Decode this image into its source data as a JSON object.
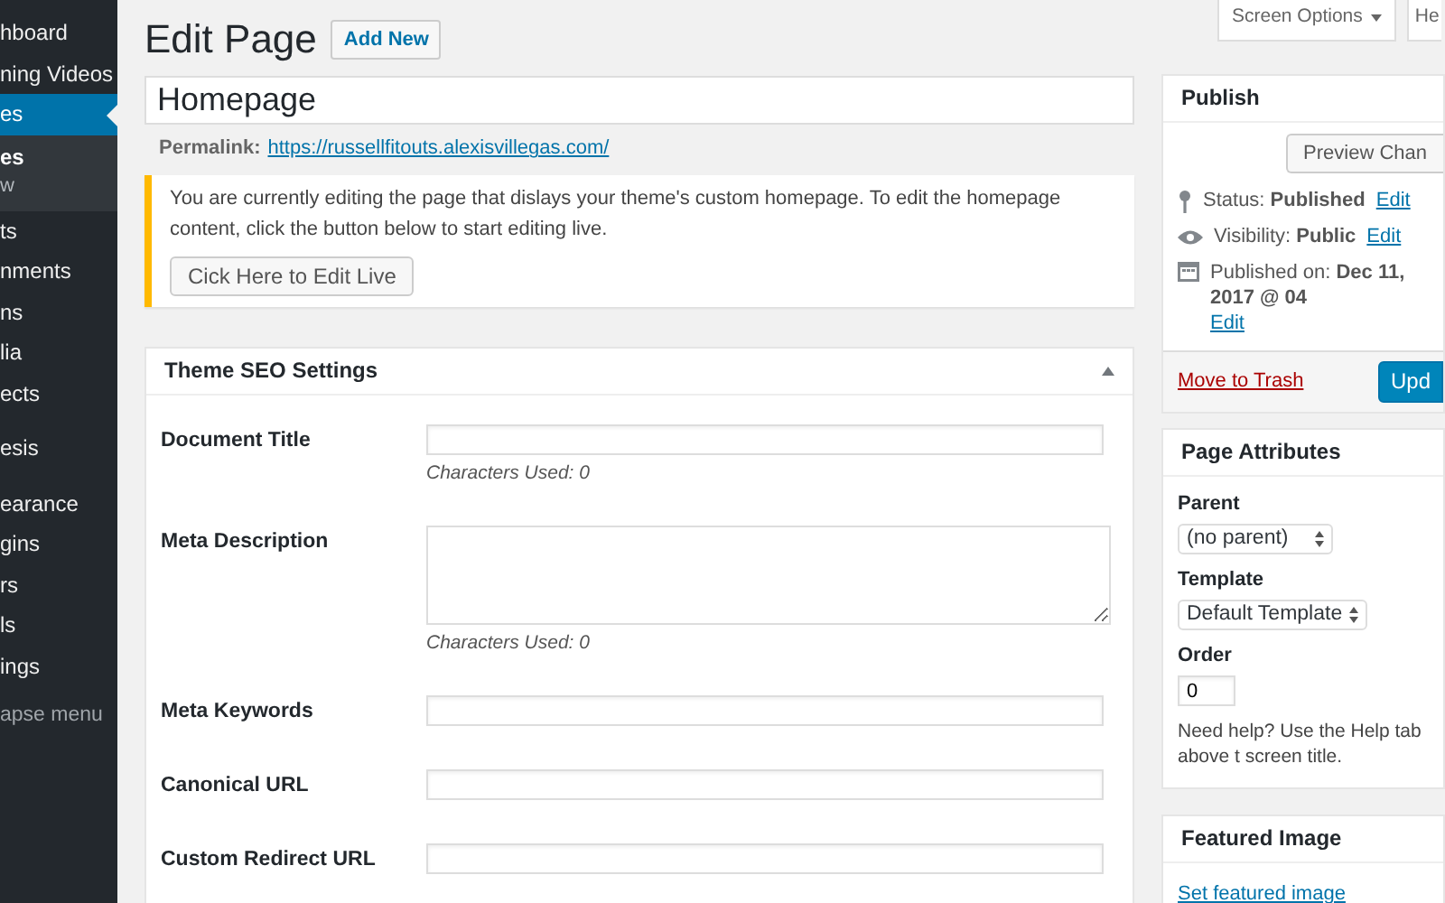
{
  "sidebar": {
    "groups": [
      [
        {
          "label": "hboard",
          "selected": false
        },
        {
          "label": "ning Videos",
          "selected": false
        },
        {
          "label": "es",
          "selected": true,
          "children": [
            {
              "label": "es",
              "selected": true
            },
            {
              "label": "w",
              "selected": false
            }
          ]
        },
        {
          "label": "ts",
          "selected": false
        },
        {
          "label": "nments",
          "selected": false
        },
        {
          "label": "ns",
          "selected": false
        },
        {
          "label": "lia",
          "selected": false
        },
        {
          "label": "ects",
          "selected": false
        }
      ],
      [
        {
          "label": "esis",
          "selected": false
        }
      ],
      [
        {
          "label": "earance",
          "selected": false
        },
        {
          "label": "gins",
          "selected": false
        },
        {
          "label": "rs",
          "selected": false
        },
        {
          "label": "ls",
          "selected": false
        },
        {
          "label": "ings",
          "selected": false
        }
      ]
    ],
    "collapse": "apse menu"
  },
  "header": {
    "title": "Edit Page",
    "add_new": "Add New",
    "screen_options": "Screen Options",
    "help": "He"
  },
  "post_title": "Homepage",
  "permalink": {
    "label": "Permalink:",
    "url": "https://russellfitouts.alexisvillegas.com/"
  },
  "notice": {
    "text": "You are currently editing the page that dislays your theme's custom homepage. To edit the homepage content, click the button below to start editing live.",
    "button": "Cick Here to Edit Live"
  },
  "seo_box": {
    "title": "Theme SEO Settings",
    "expanded": true,
    "fields": [
      {
        "kind": "input",
        "label": "Document Title",
        "hint": "Characters Used: 0"
      },
      {
        "kind": "textarea",
        "label": "Meta Description",
        "hint": "Characters Used: 0"
      },
      {
        "kind": "input",
        "label": "Meta Keywords"
      },
      {
        "kind": "input",
        "label": "Canonical URL"
      },
      {
        "kind": "input",
        "label": "Custom Redirect URL"
      }
    ]
  },
  "publish": {
    "title": "Publish",
    "preview": "Preview Chan",
    "rows": [
      {
        "kind": "status",
        "text": "Status: **Published**",
        "edit": "Edit"
      },
      {
        "kind": "visibility",
        "text": "Visibility: **Public**",
        "edit": "Edit"
      },
      {
        "kind": "date",
        "text": "Published on: **Dec 11, 2017 @ 04**",
        "edit": "Edit"
      }
    ],
    "trash": "Move to Trash",
    "update": "Upd"
  },
  "page_attributes": {
    "title": "Page Attributes",
    "parent_label": "Parent",
    "parent": "(no parent)",
    "template_label": "Template",
    "template": "Default Template",
    "order_label": "Order",
    "order": "0",
    "help": "Need help? Use the Help tab above t screen title."
  },
  "featured_image": {
    "title": "Featured Image",
    "link": "Set featured image"
  }
}
